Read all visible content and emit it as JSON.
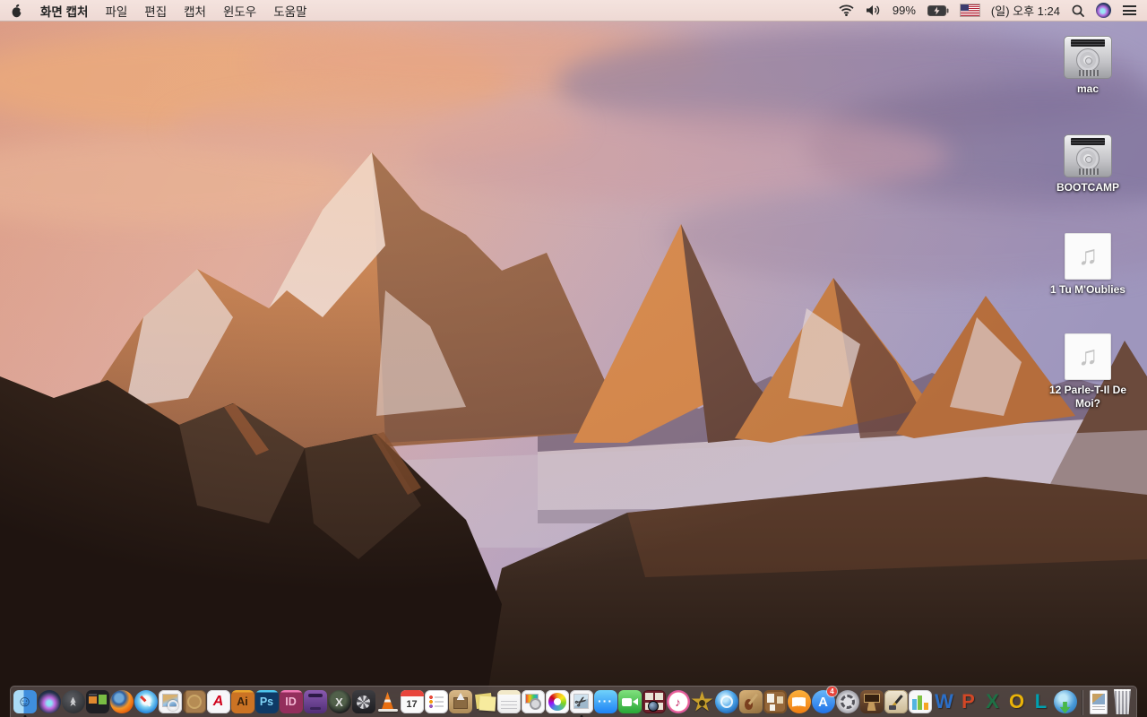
{
  "menu_bar": {
    "apple_icon": "apple-logo",
    "app_name": "화면 캡처",
    "menus": [
      "파일",
      "편집",
      "캡처",
      "윈도우",
      "도움말"
    ],
    "status": {
      "wifi_icon": "wifi-icon",
      "volume_icon": "volume-icon",
      "battery_percent": "99%",
      "battery_icon": "battery-charging-icon",
      "input_source_flag": "us-flag",
      "clock": "(일) 오후 1:24",
      "spotlight_icon": "search-icon",
      "siri_icon": "siri-icon",
      "notification_center_icon": "notification-list-icon"
    }
  },
  "desktop": {
    "icons": [
      {
        "label": "mac",
        "type": "drive"
      },
      {
        "label": "BOOTCAMP",
        "type": "drive"
      },
      {
        "label": "1 Tu M'Oublies",
        "type": "audio"
      },
      {
        "label": "12 Parle-T-Il De Moi?",
        "type": "audio"
      }
    ],
    "audio_glyph": "♫"
  },
  "dock": {
    "badge_color": "#e8453c",
    "items": [
      {
        "name": "finder",
        "running": true
      },
      {
        "name": "siri"
      },
      {
        "name": "launchpad"
      },
      {
        "name": "mission-control"
      },
      {
        "name": "firefox"
      },
      {
        "name": "safari"
      },
      {
        "name": "preview"
      },
      {
        "name": "address-book"
      },
      {
        "name": "acrobat-reader",
        "text": "A"
      },
      {
        "name": "illustrator",
        "text": "Ai"
      },
      {
        "name": "photoshop",
        "text": "Ps"
      },
      {
        "name": "indesign",
        "text": "ID"
      },
      {
        "name": "toast"
      },
      {
        "name": "xee",
        "text": "X"
      },
      {
        "name": "fan-control"
      },
      {
        "name": "vlc"
      },
      {
        "name": "calendar",
        "text": "17"
      },
      {
        "name": "reminders"
      },
      {
        "name": "stuffit-expander"
      },
      {
        "name": "stickies"
      },
      {
        "name": "textedit"
      },
      {
        "name": "colorsync"
      },
      {
        "name": "photos"
      },
      {
        "name": "grab",
        "running": true
      },
      {
        "name": "messages"
      },
      {
        "name": "facetime"
      },
      {
        "name": "photo-booth"
      },
      {
        "name": "itunes"
      },
      {
        "name": "imovie"
      },
      {
        "name": "dvd-player"
      },
      {
        "name": "garageband"
      },
      {
        "name": "corkboard"
      },
      {
        "name": "ibooks"
      },
      {
        "name": "app-store",
        "text": "A",
        "badge": "4"
      },
      {
        "name": "system-preferences"
      },
      {
        "name": "keynote"
      },
      {
        "name": "pages"
      },
      {
        "name": "numbers"
      },
      {
        "name": "word",
        "text": "W"
      },
      {
        "name": "powerpoint",
        "text": "P"
      },
      {
        "name": "excel",
        "text": "X"
      },
      {
        "name": "outlook",
        "text": "O"
      },
      {
        "name": "lync",
        "text": "L"
      },
      {
        "name": "downloader"
      },
      {
        "name": "divider",
        "divider": true
      },
      {
        "name": "downloads-document"
      },
      {
        "name": "trash"
      }
    ]
  }
}
